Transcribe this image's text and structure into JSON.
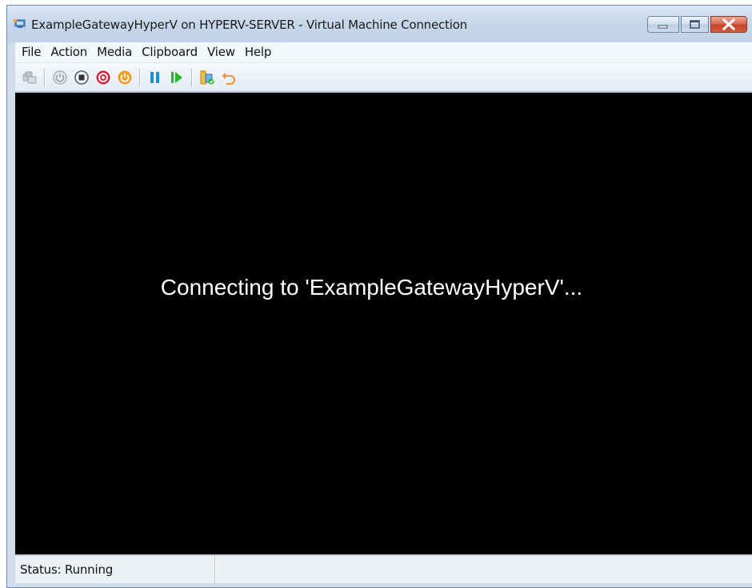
{
  "window": {
    "title": "ExampleGatewayHyperV on HYPERV-SERVER - Virtual Machine Connection",
    "app_icon": "vm-connection-icon",
    "caption_buttons": [
      "minimize-icon",
      "maximize-icon",
      "close-icon"
    ]
  },
  "menubar": {
    "items": [
      {
        "label": "File"
      },
      {
        "label": "Action"
      },
      {
        "label": "Media"
      },
      {
        "label": "Clipboard"
      },
      {
        "label": "View"
      },
      {
        "label": "Help"
      }
    ]
  },
  "toolbar": {
    "icons": [
      "ctrl-alt-del-icon",
      "start-icon",
      "turn-off-icon",
      "shut-down-icon",
      "save-icon",
      "pause-icon",
      "resume-icon",
      "checkpoint-icon",
      "revert-icon"
    ]
  },
  "screen": {
    "message": "Connecting to 'ExampleGatewayHyperV'..."
  },
  "statusbar": {
    "status_text": "Status: Running",
    "secondary_text": ""
  },
  "colors": {
    "frame": "#cfdcea",
    "screen_bg": "#000000",
    "message_text": "#ffffff",
    "close_red": "#c4412a",
    "pause_blue": "#1e90d8",
    "resume_green": "#2cb52c",
    "save_orange": "#f0a020",
    "shutdown_red": "#e0203a"
  }
}
